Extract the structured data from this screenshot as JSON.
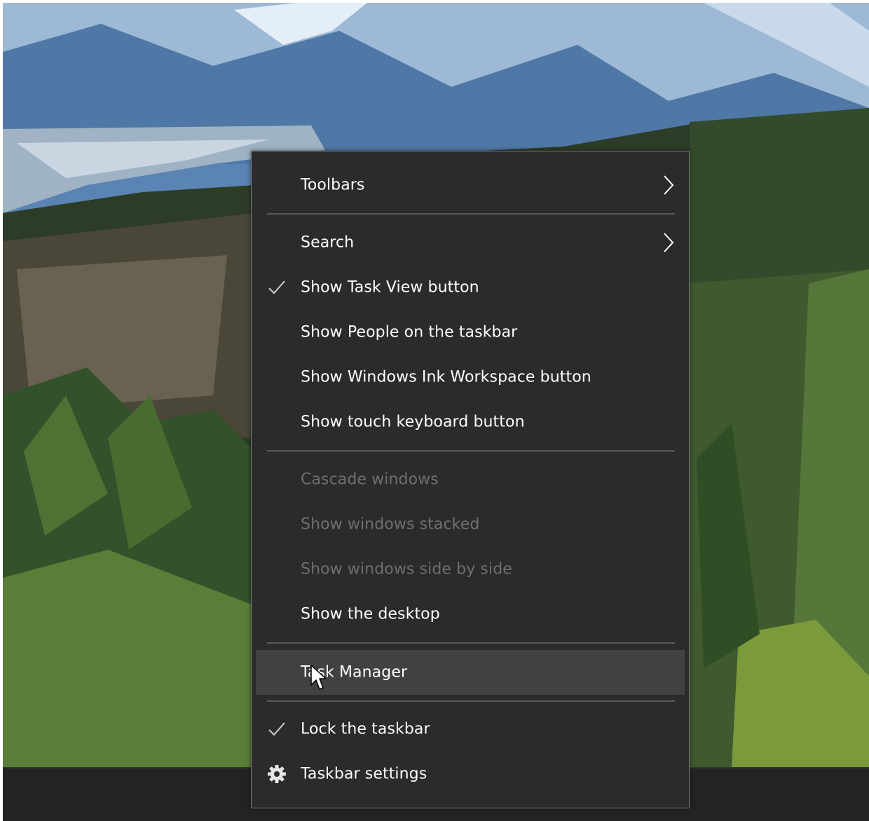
{
  "menu": {
    "items": {
      "toolbars": {
        "label": "Toolbars",
        "icon": "chevron-right-icon"
      },
      "search": {
        "label": "Search",
        "icon": "chevron-right-icon"
      },
      "show_task_view": {
        "label": "Show Task View button",
        "checked": true,
        "icon": "checkmark-icon"
      },
      "show_people": {
        "label": "Show People on the taskbar",
        "checked": false
      },
      "show_ink_workspace": {
        "label": "Show Windows Ink Workspace button",
        "checked": false
      },
      "show_touch_keyboard": {
        "label": "Show touch keyboard button",
        "checked": false
      },
      "cascade_windows": {
        "label": "Cascade windows",
        "disabled": true
      },
      "show_windows_stacked": {
        "label": "Show windows stacked",
        "disabled": true
      },
      "show_windows_side_by_side": {
        "label": "Show windows side by side",
        "disabled": true
      },
      "show_desktop": {
        "label": "Show the desktop"
      },
      "task_manager": {
        "label": "Task Manager",
        "highlighted": true
      },
      "lock_taskbar": {
        "label": "Lock the taskbar",
        "checked": true,
        "icon": "checkmark-icon"
      },
      "taskbar_settings": {
        "label": "Taskbar settings",
        "icon": "gear-icon"
      }
    }
  },
  "colors": {
    "menu_background": "#2b2b2b",
    "menu_border": "#7b7b7b",
    "highlight": "#414141",
    "text": "#ffffff",
    "disabled_text": "#6f6f6f",
    "taskbar": "#232323"
  }
}
